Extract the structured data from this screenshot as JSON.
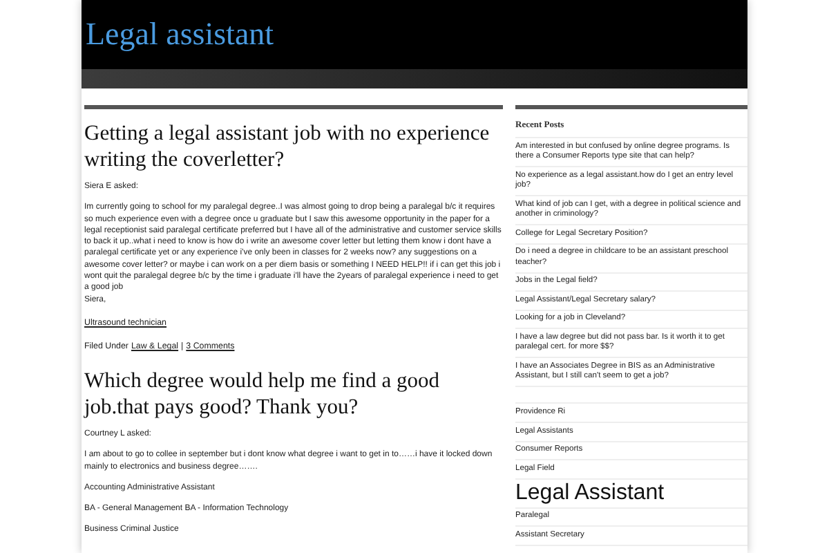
{
  "header": {
    "title": "Legal assistant"
  },
  "posts": [
    {
      "title": "Getting a legal assistant job with no experience writing the coverletter?",
      "author": "Siera E asked:",
      "paragraphs": [
        "Im currently going to school for my paralegal degree..I was almost going to drop being a paralegal b/c it requires so much experience even with a degree once u graduate but I saw this awesome opportunity in the paper for a legal receptionist said paralegal certificate preferred but I have all of the administrative and customer service skills to back it up..what i need to know is how do i write an awesome cover letter but letting them know i dont have a paralegal certificate yet or any experience i've only been in classes for 2 weeks now? any suggestions on a awesome cover letter? or maybe i can work on a per diem basis or something I NEED HELP!! if i can get this job i wont quit the paralegal degree b/c by the time i graduate i'll have the 2years of paralegal experience i need to get a good job\nSiera,"
      ],
      "link": "Ultrasound technician",
      "filed_label": "Filed Under",
      "category": "Law & Legal",
      "separator": "|",
      "comments": "3 Comments"
    },
    {
      "title": "Which degree would help me find a good job.that pays good? Thank you?",
      "author": "Courtney L asked:",
      "paragraphs": [
        "I am about to go to collee in september but i dont know what degree i want to get in to……i have it locked down mainly to electronics and business degree…….",
        "Accounting Administrative Assistant",
        "BA - General Management BA - Information Technology",
        "Business Criminal Justice"
      ]
    }
  ],
  "sidebar": {
    "recent_title": "Recent Posts",
    "recent_posts": [
      "Am interested in but confused by online degree programs. Is there a Consumer Reports type site that can help?",
      "No experience as a legal assistant.how do I get an entry level job?",
      "What kind of job can I get, with a degree in political science and another in criminology?",
      "College for Legal Secretary Position?",
      "Do i need a degree in childcare to be an assistant preschool teacher?",
      "Jobs in the Legal field?",
      "Legal Assistant/Legal Secretary salary?",
      "Looking for a job in Cleveland?",
      "I have a law degree but did not pass bar. Is it worth it to get paralegal cert. for more $$?",
      "I have an Associates Degree in BIS as an Administrative Assistant, but I still can't seem to get a job?"
    ],
    "links": [
      "Providence Ri",
      "Legal Assistants",
      "Consumer Reports",
      "Legal Field"
    ],
    "section_title": "Legal Assistant",
    "section_links": [
      "Paralegal",
      "Assistant Secretary"
    ]
  }
}
